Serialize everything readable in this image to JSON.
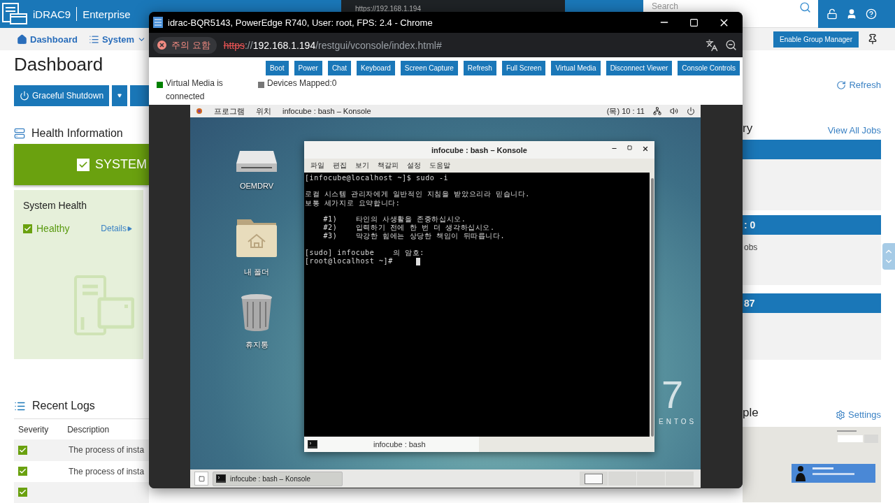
{
  "header": {
    "product": "iDRAC9",
    "edition": "Enterprise",
    "search": {
      "placeholder": "Search"
    }
  },
  "background_window": {
    "url": "https://192.168.1.194"
  },
  "nav": [
    {
      "label": "Dashboard",
      "kind": "home"
    },
    {
      "label": "System",
      "kind": "menu"
    }
  ],
  "group_manager_button": "Enable Group Manager",
  "page_title": "Dashboard",
  "actions": {
    "shutdown": "Graceful Shutdown",
    "refresh": "Refresh"
  },
  "health": {
    "title": "Health Information",
    "banner": "SYSTEM",
    "panel_title": "System Health",
    "status": "Healthy",
    "details": "Details"
  },
  "logs": {
    "title": "Recent Logs",
    "columns": [
      "Severity",
      "Description"
    ],
    "rows": [
      {
        "ok": true,
        "description": "The process of insta"
      },
      {
        "ok": true,
        "description": "The process of insta"
      },
      {
        "ok": true
      }
    ]
  },
  "jobs": {
    "title": "ry",
    "link": "View All Jobs",
    "panels": [
      {
        "kind": "blank"
      },
      {
        "kind": "titled",
        "header": ": 0",
        "body": "obs"
      },
      {
        "kind": "titled",
        "header": "87"
      }
    ]
  },
  "console_preview": {
    "title": "ple",
    "settings": "Settings",
    "kind": "picture"
  },
  "popup": {
    "title": "idrac-BQR5143, PowerEdge R740, User: root, FPS: 2.4 - Chrome",
    "security": "주의 요함",
    "url": {
      "scheme": "https",
      "separator": "://",
      "host": "192.168.1.194",
      "path": "/restgui/vconsole/index.html#"
    },
    "buttons": [
      "Boot",
      "Power",
      "Chat",
      "Keyboard",
      "Screen Capture",
      "Refresh",
      "Full Screen",
      "Virtual Media",
      "Disconnect Viewer",
      "Console Controls"
    ],
    "status": [
      {
        "label": "Virtual Media is connected",
        "color": "#008000"
      },
      {
        "label": "Devices Mapped:0",
        "color": "#777777"
      }
    ]
  },
  "desktop": {
    "menu": [
      "프로그램",
      "위치"
    ],
    "active_app": "infocube : bash – Konsole",
    "clock": "(목) 10 : 11",
    "icons": [
      {
        "label": "OEMDRV",
        "kind": "drive"
      },
      {
        "label": "내 폴더",
        "kind": "folder"
      },
      {
        "label": "휴지통",
        "kind": "trash"
      }
    ],
    "wallpaper_logo": {
      "numeral": "7",
      "word": "ENTOS"
    },
    "konsole": {
      "title": "infocube : bash – Konsole",
      "menu": [
        "파일",
        "편집",
        "보기",
        "책갈피",
        "설정",
        "도움말"
      ],
      "paragraphs": [
        [
          {
            "text": "[infocube@localhost ~]$ sudo -i"
          }
        ],
        [
          {
            "text": "로컬 시스템 관리자에게 일반적인 지침을 받았으리라 믿습니다."
          },
          {
            "text": "보통 세가지로 요약합니다:"
          }
        ],
        [
          {
            "text": "    #1)    타인의 사생활을 존중하십시오."
          },
          {
            "text": "    #2)    입력하기 전에 한 번 더 생각하십시오."
          },
          {
            "text": "    #3)    막강한 힘에는 상당한 책임이 뒤따릅니다."
          }
        ],
        [
          {
            "text": "[sudo] infocube    의 암호:"
          },
          {
            "text": "[root@localhost ~]#     ",
            "cursor": true
          }
        ]
      ],
      "tab": "infocube : bash"
    },
    "taskbar": {
      "task": "infocube : bash – Konsole"
    },
    "workspaces": [
      {
        "selected": true
      },
      {
        "selected": false
      },
      {
        "selected": false
      },
      {
        "selected": false
      }
    ]
  }
}
